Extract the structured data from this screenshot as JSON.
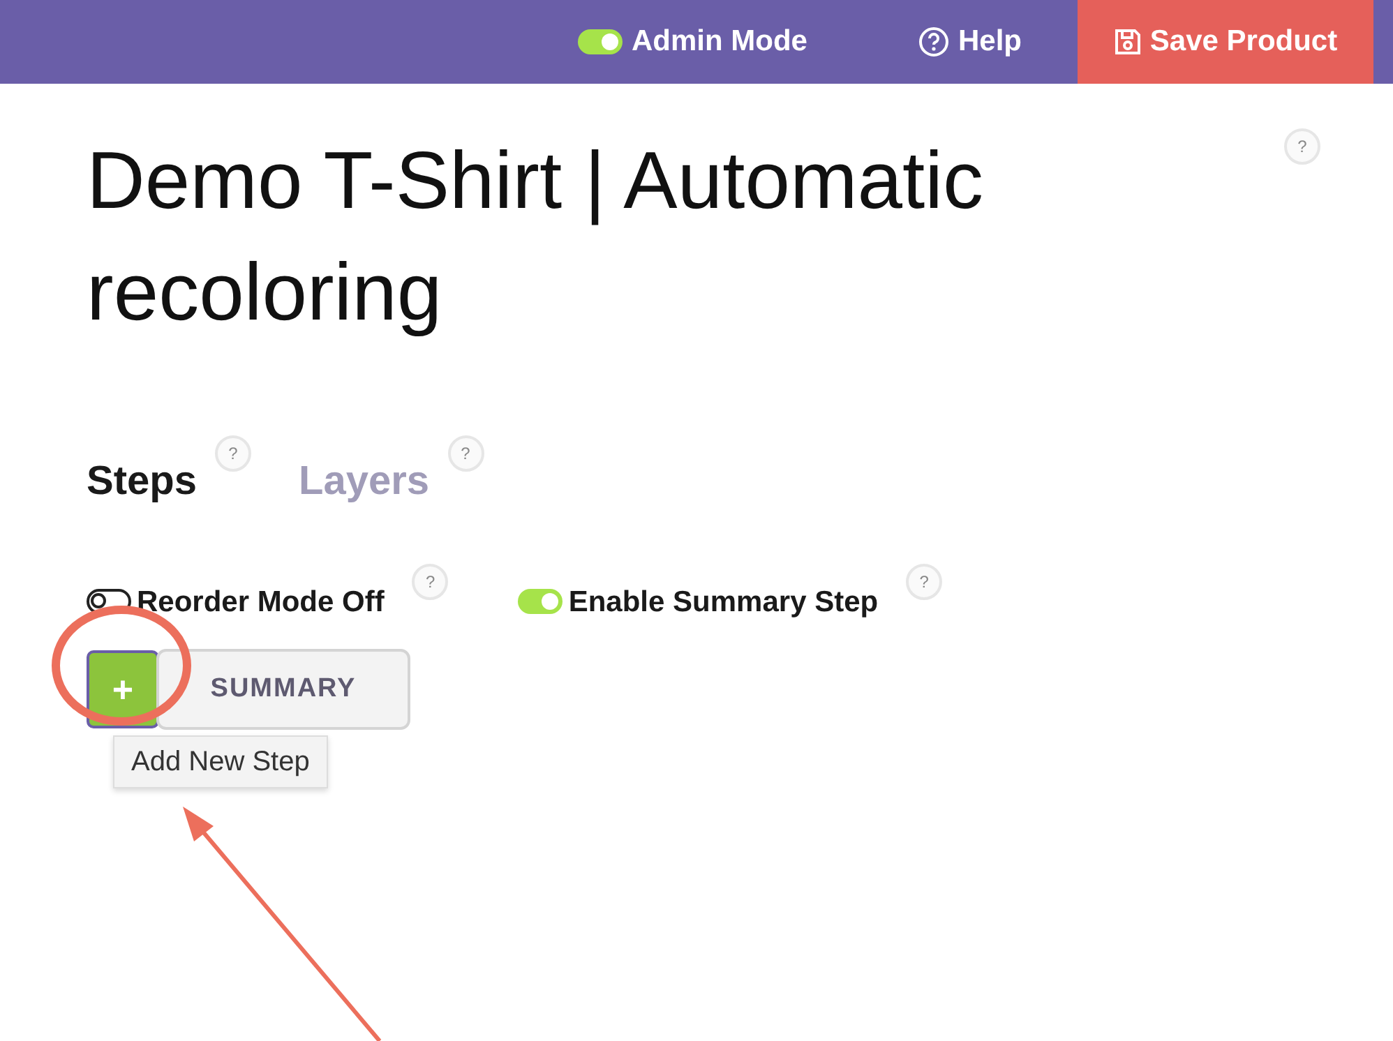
{
  "top_bar": {
    "admin_mode": {
      "label": "Admin Mode",
      "on": true
    },
    "help": {
      "label": "Help"
    },
    "save": {
      "label": "Save Product"
    }
  },
  "title": "Demo T-Shirt | Automatic recoloring",
  "title_help": "?",
  "tabs": [
    {
      "label": "Steps",
      "selected": true,
      "help": "?"
    },
    {
      "label": "Layers",
      "selected": false,
      "help": "?"
    }
  ],
  "toggles": [
    {
      "label": "Reorder Mode Off",
      "on": false,
      "help": "?"
    },
    {
      "label": "Enable Summary Step",
      "on": true,
      "help": "?"
    }
  ],
  "steps": {
    "add_button": {
      "label": "+"
    },
    "items": [
      {
        "label": "SUMMARY"
      }
    ]
  },
  "tooltip": {
    "text": "Add New Step"
  }
}
